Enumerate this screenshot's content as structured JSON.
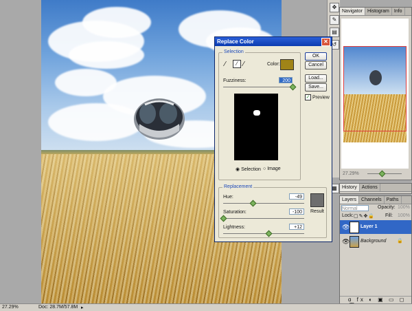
{
  "dialog": {
    "title": "Replace Color",
    "selection_label": "Selection",
    "color_label": "Color:",
    "color_swatch": "#a08418",
    "fuzziness_label": "Fuzziness:",
    "fuzziness_value": "200",
    "fuzziness_level": 1.0,
    "preview_radio_selection": "Selection",
    "preview_radio_image": "Image",
    "preview_checkbox": "Preview",
    "buttons": {
      "ok": "OK",
      "cancel": "Cancel",
      "load": "Load...",
      "save": "Save..."
    },
    "replacement_label": "Replacement",
    "hue_label": "Hue:",
    "hue_value": "-49",
    "saturation_label": "Saturation:",
    "saturation_value": "-100",
    "lightness_label": "Lightness:",
    "lightness_value": "+12",
    "result_label": "Result",
    "result_swatch": "#6e6e6e"
  },
  "navigator": {
    "tabs": [
      "Navigator",
      "Histogram",
      "Info"
    ],
    "zoom": "27.29%"
  },
  "history": {
    "tabs": [
      "History",
      "Actions"
    ]
  },
  "layers": {
    "tabs": [
      "Layers",
      "Channels",
      "Paths"
    ],
    "blend_mode": "Normal",
    "opacity_label": "Opacity:",
    "opacity_value": "100%",
    "lock_label": "Lock:",
    "fill_label": "Fill:",
    "fill_value": "100%",
    "items": [
      {
        "name": "Layer 1",
        "selected": true
      },
      {
        "name": "Background",
        "selected": false
      }
    ]
  },
  "status": {
    "zoom": "27.29%",
    "doc": "Doc: 28.7M/57.8M"
  }
}
